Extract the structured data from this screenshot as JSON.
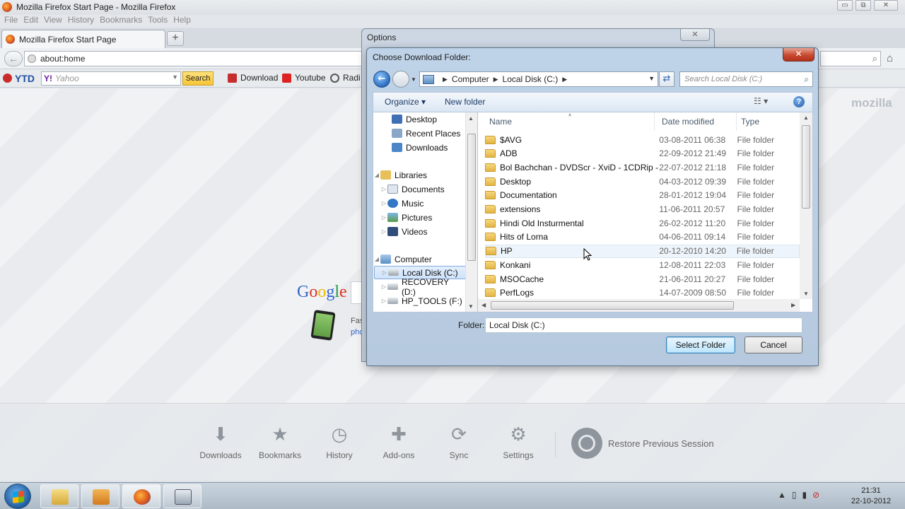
{
  "firefox": {
    "window_title": "Mozilla Firefox Start Page - Mozilla Firefox",
    "window_controls": [
      "▭",
      "⧉",
      "✕"
    ],
    "menu": [
      "File",
      "Edit",
      "View",
      "History",
      "Bookmarks",
      "Tools",
      "Help"
    ],
    "tab_title": "Mozilla Firefox Start Page",
    "new_tab_label": "+",
    "url": "about:home",
    "toolbar": {
      "ytd_label": "YTD",
      "yahoo_brand": "Y!",
      "yahoo_placeholder": "Yahoo",
      "search_button": "Search",
      "download_label": "Download",
      "youtube_label": "Youtube",
      "radio_label": "Radi"
    },
    "mozilla_mark": "mozilla",
    "google_logo": [
      "G",
      "o",
      "o",
      "g",
      "l",
      "e"
    ],
    "promo_line1": "Fas",
    "promo_line2": "pho",
    "launcher": [
      {
        "label": "Downloads",
        "icon": "download-icon"
      },
      {
        "label": "Bookmarks",
        "icon": "star-icon"
      },
      {
        "label": "History",
        "icon": "clock-icon"
      },
      {
        "label": "Add-ons",
        "icon": "puzzle-icon"
      },
      {
        "label": "Sync",
        "icon": "sync-icon"
      },
      {
        "label": "Settings",
        "icon": "gear-icon"
      }
    ],
    "restore_session": "Restore Previous Session"
  },
  "options_dialog": {
    "title": "Options",
    "close_label": "✕"
  },
  "choose_dialog": {
    "title": "Choose Download Folder:",
    "close_label": "✕",
    "address": {
      "root": "Computer",
      "current": "Local Disk (C:)"
    },
    "search_placeholder": "Search Local Disk (C:)",
    "organize_label": "Organize ▾",
    "new_folder_label": "New folder",
    "nav_pane": {
      "favorites": [
        {
          "label": "Desktop",
          "color": "#3f6fb5"
        },
        {
          "label": "Recent Places",
          "color": "#8aa7c9"
        },
        {
          "label": "Downloads",
          "color": "#4a86c8"
        }
      ],
      "libraries_label": "Libraries",
      "libraries": [
        "Documents",
        "Music",
        "Pictures",
        "Videos"
      ],
      "computer_label": "Computer",
      "drives": [
        "Local Disk (C:)",
        "RECOVERY (D:)",
        "HP_TOOLS (F:)"
      ]
    },
    "columns": [
      "Name",
      "Date modified",
      "Type"
    ],
    "files": [
      {
        "name": "$AVG",
        "date": "03-08-2011 06:38",
        "type": "File folder"
      },
      {
        "name": "ADB",
        "date": "22-09-2012 21:49",
        "type": "File folder"
      },
      {
        "name": "Bol Bachchan - DVDScr - XviD - 1CDRip -...",
        "date": "22-07-2012 21:18",
        "type": "File folder"
      },
      {
        "name": "Desktop",
        "date": "04-03-2012 09:39",
        "type": "File folder"
      },
      {
        "name": "Documentation",
        "date": "28-01-2012 19:04",
        "type": "File folder"
      },
      {
        "name": "extensions",
        "date": "11-06-2011 20:57",
        "type": "File folder"
      },
      {
        "name": "Hindi Old Insturmental",
        "date": "26-02-2012 11:20",
        "type": "File folder"
      },
      {
        "name": "Hits of Lorna",
        "date": "04-06-2011 09:14",
        "type": "File folder"
      },
      {
        "name": "HP",
        "date": "20-12-2010 14:20",
        "type": "File folder"
      },
      {
        "name": "Konkani",
        "date": "12-08-2011 22:03",
        "type": "File folder"
      },
      {
        "name": "MSOCache",
        "date": "21-06-2011 20:27",
        "type": "File folder"
      },
      {
        "name": "PerfLogs",
        "date": "14-07-2009 08:50",
        "type": "File folder"
      }
    ],
    "folder_label": "Folder:",
    "folder_value": "Local Disk (C:)",
    "select_button": "Select Folder",
    "cancel_button": "Cancel"
  },
  "taskbar": {
    "time": "21:31",
    "date": "22-10-2012"
  }
}
